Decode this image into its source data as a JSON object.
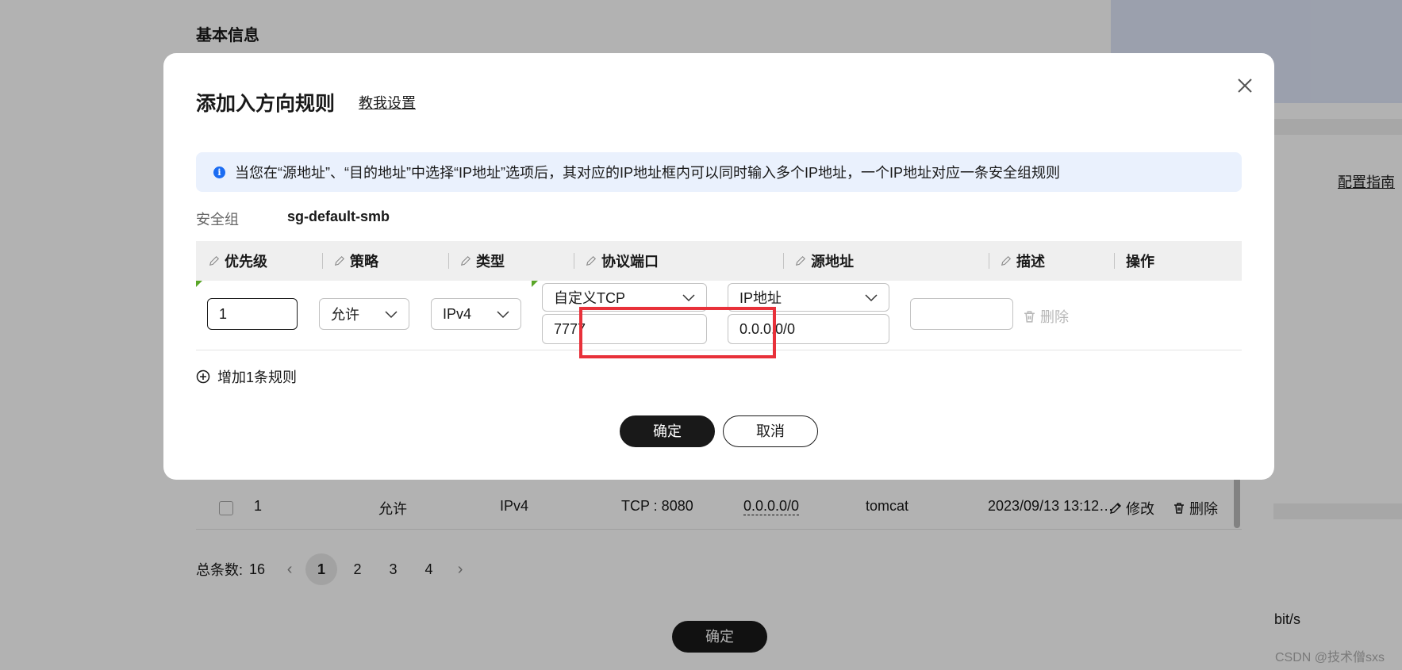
{
  "background": {
    "section_title": "基本信息",
    "guide_link": "配置指南",
    "row": {
      "priority": "1",
      "policy": "允许",
      "type": "IPv4",
      "port": "TCP : 8080",
      "source": "0.0.0.0/0",
      "description": "tomcat",
      "time": "2023/09/13 13:12…",
      "edit_label": "修改",
      "delete_label": "删除"
    },
    "pagination": {
      "total_label": "总条数:",
      "total": "16",
      "prev": "‹",
      "next": "›",
      "pages": [
        "1",
        "2",
        "3",
        "4"
      ],
      "current": "1"
    },
    "confirm_label": "确定",
    "bits_text": "bit/s"
  },
  "watermark": "CSDN @技术僧sxs",
  "modal": {
    "title": "添加入方向规则",
    "help_link": "教我设置",
    "info_text": "当您在“源地址”、“目的地址”中选择“IP地址”选项后，其对应的IP地址框内可以同时输入多个IP地址，一个IP地址对应一条安全组规则",
    "security_group_label": "安全组",
    "security_group_value": "sg-default-smb",
    "columns": [
      "优先级",
      "策略",
      "类型",
      "协议端口",
      "源地址",
      "描述",
      "操作"
    ],
    "rule": {
      "priority": "1",
      "policy": "允许",
      "type": "IPv4",
      "protocol": "自定义TCP",
      "port": "7777",
      "source_type": "IP地址",
      "source_ip": "0.0.0.0/0",
      "description": "",
      "delete_label": "删除"
    },
    "add_rule_label": "增加1条规则",
    "confirm_label": "确定",
    "cancel_label": "取消"
  },
  "colors": {
    "primary": "#191919",
    "info_bg": "#eaf1fd",
    "info_icon": "#1b6cf2",
    "highlight": "#e8313a",
    "edited_marker": "#5aa628"
  }
}
